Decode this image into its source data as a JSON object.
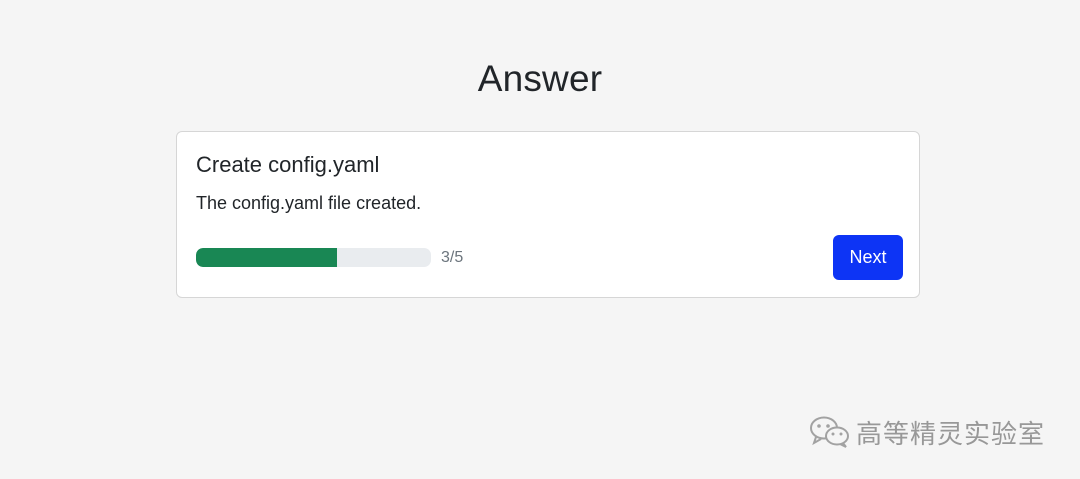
{
  "page": {
    "title": "Answer"
  },
  "card": {
    "title": "Create config.yaml",
    "text": "The config.yaml file created.",
    "progress": {
      "current": 3,
      "total": 5,
      "label": "3/5",
      "fraction": 0.6
    },
    "next_label": "Next"
  },
  "watermark": {
    "icon": "wechat-icon",
    "text": "高等精灵实验室"
  },
  "colors": {
    "background": "#f5f5f5",
    "progress_fill": "#198754",
    "progress_track": "#e9ecef",
    "button": "#0d34f5"
  }
}
